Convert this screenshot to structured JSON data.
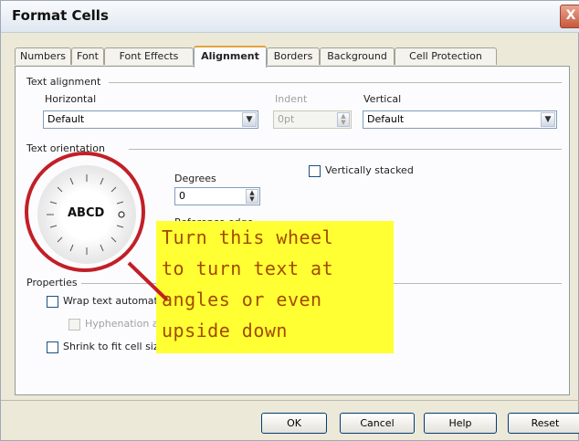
{
  "window": {
    "title": "Format Cells",
    "close_glyph": "X"
  },
  "tabs": [
    {
      "label": "Numbers"
    },
    {
      "label": "Font"
    },
    {
      "label": "Font Effects"
    },
    {
      "label": "Alignment"
    },
    {
      "label": "Borders"
    },
    {
      "label": "Background"
    },
    {
      "label": "Cell Protection"
    }
  ],
  "active_tab": "Alignment",
  "text_alignment": {
    "section_label": "Text alignment",
    "horizontal_label": "Horizontal",
    "horizontal_value": "Default",
    "indent_label": "Indent",
    "indent_value": "0pt",
    "vertical_label": "Vertical",
    "vertical_value": "Default"
  },
  "text_orientation": {
    "section_label": "Text orientation",
    "wheel_text": "ABCD",
    "degrees_label": "Degrees",
    "degrees_value": "0",
    "reference_edge_label": "Reference edge",
    "vertically_stacked_label": "Vertically stacked"
  },
  "properties": {
    "section_label": "Properties",
    "wrap_label": "Wrap text automatically",
    "hyphenation_label": "Hyphenation active",
    "shrink_label": "Shrink to fit cell size"
  },
  "buttons": {
    "ok": "OK",
    "cancel": "Cancel",
    "help": "Help",
    "reset": "Reset"
  },
  "annotation": {
    "lines": [
      "Turn this wheel",
      "to turn text at",
      "angles or even",
      "upside down"
    ],
    "highlight_color": "#ffff33",
    "text_color": "#a14b00",
    "circle_color": "#c21f27"
  }
}
